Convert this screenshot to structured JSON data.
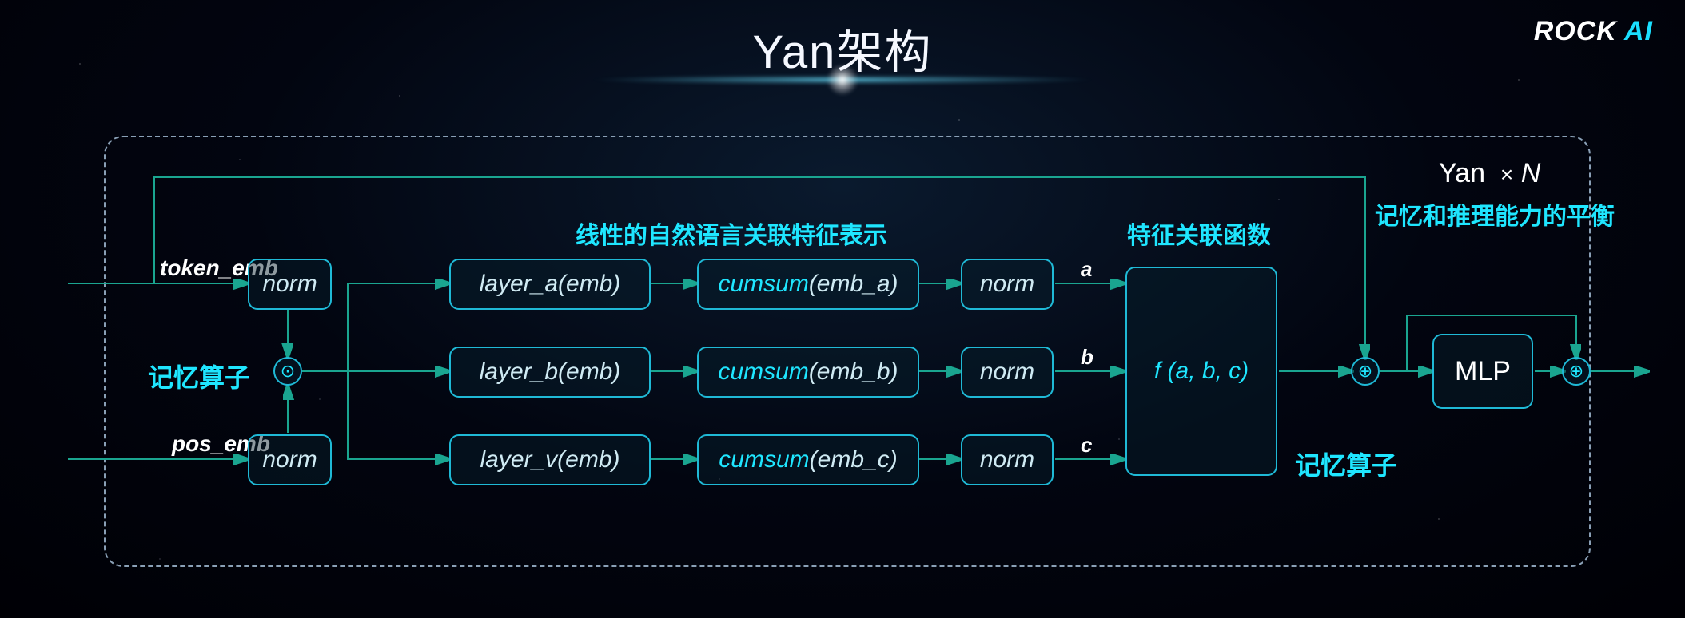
{
  "title": "Yan架构",
  "logo": {
    "rock": "ROCK",
    "ai": " AI"
  },
  "inputs": {
    "token": "token_emb",
    "pos": "pos_emb"
  },
  "norm_label": "norm",
  "memory_operator": "记忆算子",
  "hadamard_symbol": "⊙",
  "section_linear": "线性的自然语言关联特征表示",
  "section_corr": "特征关联函数",
  "layers": {
    "a": "layer_a(emb)",
    "b": "layer_b(emb)",
    "v": "layer_v(emb)"
  },
  "cumsum_prefix": "cumsum",
  "cumsum_args": {
    "a": "(emb_a)",
    "b": "(emb_b)",
    "c": "(emb_c)"
  },
  "edge_a": "a",
  "edge_b": "b",
  "edge_c": "c",
  "f_box": "f (a, b, c)",
  "memory_operator2": "记忆算子",
  "plus_symbol": "⊕",
  "mlp": "MLP",
  "yan_times_n": {
    "yan": "Yan",
    "x": "×",
    "n": "N"
  },
  "balance": "记忆和推理能力的平衡"
}
